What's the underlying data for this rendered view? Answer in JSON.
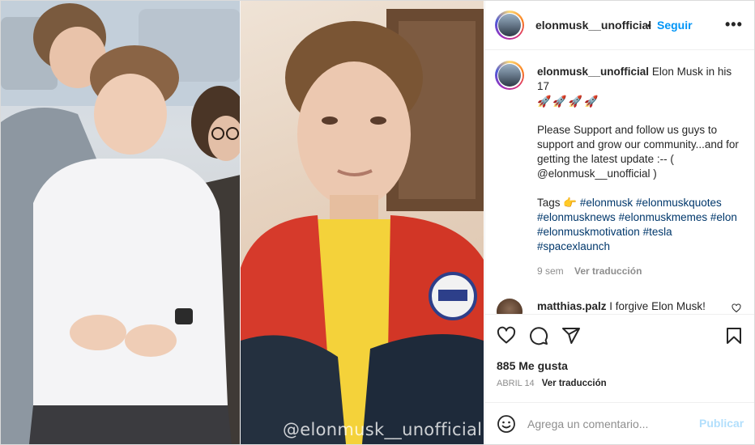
{
  "photo": {
    "watermark": "@elonmusk__unofficial",
    "left_description_icon": "photo-left-boy",
    "right_description_icon": "photo-right-teen"
  },
  "header": {
    "username": "elonmusk__unofficial",
    "separator": "•",
    "follow_label": "Seguir",
    "more_label": "•••"
  },
  "caption": {
    "username": "elonmusk__unofficial",
    "text_line1": "Elon Musk in his 17",
    "rockets": "🚀🚀🚀🚀",
    "paragraph": "Please Support and follow us guys to support and grow our community...and for getting the latest update :-- ( @elonmusk__unofficial )",
    "tags_label": "Tags",
    "tags_emoji": "👉",
    "hashtags": [
      "#elonmusk",
      "#elonmuskquotes",
      "#elonmusknews",
      "#elonmuskmemes",
      "#elon",
      "#elonmuskmotivation",
      "#tesla",
      "#spacexlaunch"
    ],
    "time_ago": "9 sem",
    "translate_label": "Ver traducción"
  },
  "comment": {
    "username": "matthias.palz",
    "text": "I forgive Elon Musk!"
  },
  "likes": "885 Me gusta",
  "date": "ABRIL 14",
  "date_translate_label": "Ver traducción",
  "comment_box": {
    "placeholder": "Agrega un comentario...",
    "post_label": "Publicar"
  },
  "colors": {
    "accent": "#0095f6",
    "post_disabled": "#b2dffc",
    "hashtag": "#00376b",
    "muted": "#8e8e8e"
  }
}
